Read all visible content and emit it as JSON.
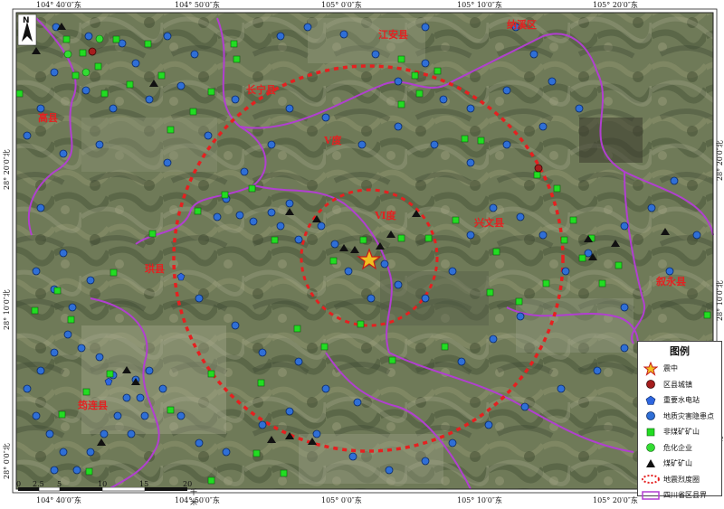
{
  "map": {
    "place_labels": {
      "jiangan": "江安县",
      "naxi": "纳溪区",
      "changning": "长宁县",
      "gaoxian": "高县",
      "intensity_v": "Ⅴ度",
      "intensity_vi": "Ⅵ度",
      "xingwen": "兴文县",
      "gongxian": "珙县",
      "xuyong": "叙永县",
      "junlian": "筠连县"
    },
    "ticks": {
      "top": [
        "104° 40′0″东",
        "104° 50′0″东",
        "105° 0′0″东",
        "105° 10′0″东",
        "105° 20′0″东"
      ],
      "bottom": [
        "104° 40′0″东",
        "104° 50′0″东",
        "105° 0′0″东",
        "105° 10′0″东",
        "105° 20′0″东"
      ],
      "left": [
        "28° 20′0″北",
        "28° 10′0″北",
        "28° 0′0″北"
      ],
      "right": [
        "28° 20′0″北",
        "28° 10′0″北",
        "28° 0′0″北"
      ]
    },
    "scale_bar": {
      "labels": [
        "0",
        "2.5",
        "5",
        "10",
        "15",
        "20"
      ],
      "unit": "千米"
    },
    "north_arrow_label": "N",
    "colors": {
      "county_boundary": "#b13fd0",
      "intensity_circle": "#e52020",
      "hazard_point": "#2f6fd6",
      "nonmetal_mine": "#22dd22",
      "coal_mine": "#111111",
      "hydropower": "#2e66e0",
      "town": "#a51d1d",
      "chemical": "#33dd33",
      "epicenter": "#f0c020"
    }
  },
  "legend": {
    "title": "图例",
    "items": [
      {
        "label": "震中",
        "icon": "star-icon"
      },
      {
        "label": "区县城镇",
        "icon": "town-dot-icon"
      },
      {
        "label": "重要水电站",
        "icon": "pentagon-icon"
      },
      {
        "label": "地质灾害隐患点",
        "icon": "blue-dot-icon"
      },
      {
        "label": "非煤矿矿山",
        "icon": "green-square-icon"
      },
      {
        "label": "危化企业",
        "icon": "green-dot-icon"
      },
      {
        "label": "煤矿矿山",
        "icon": "black-triangle-icon"
      },
      {
        "label": "地震烈度圈",
        "icon": "dashed-ellipse-icon"
      },
      {
        "label": "四川省区县界",
        "icon": "purple-rect-icon"
      }
    ]
  }
}
